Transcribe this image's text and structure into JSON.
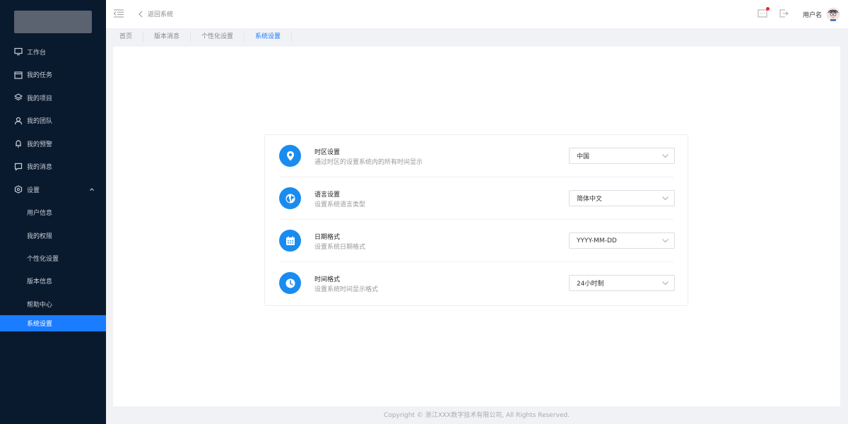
{
  "sidebar": {
    "items": [
      {
        "label": "工作台",
        "icon": "monitor-icon"
      },
      {
        "label": "我的任务",
        "icon": "calendar-icon"
      },
      {
        "label": "我的项目",
        "icon": "layers-icon"
      },
      {
        "label": "我的团队",
        "icon": "user-icon"
      },
      {
        "label": "我的预警",
        "icon": "bell-icon"
      },
      {
        "label": "我的消息",
        "icon": "message-icon"
      },
      {
        "label": "设置",
        "icon": "settings-hex-icon"
      }
    ],
    "submenu": [
      {
        "label": "用户信息"
      },
      {
        "label": "我的权限"
      },
      {
        "label": "个性化设置"
      },
      {
        "label": "版本信息"
      },
      {
        "label": "帮助中心"
      },
      {
        "label": "系统设置"
      }
    ]
  },
  "header": {
    "back_label": "返回系统",
    "username": "用户名"
  },
  "tabs": [
    {
      "label": "首页"
    },
    {
      "label": "版本消息"
    },
    {
      "label": "个性化设置"
    },
    {
      "label": "系统设置"
    }
  ],
  "settings": [
    {
      "title": "时区设置",
      "desc": "通过时区的设置系统内的所有时间显示",
      "value": "中国",
      "icon": "location-pin-icon"
    },
    {
      "title": "语言设置",
      "desc": "设置系统语言类型",
      "value": "简体中文",
      "icon": "globe-icon"
    },
    {
      "title": "日期格式",
      "desc": "设置系统日期格式",
      "value": "YYYY-MM-DD",
      "icon": "calendar-icon"
    },
    {
      "title": "时间格式",
      "desc": "设置系统时间显示格式",
      "value": "24小时制",
      "icon": "clock-icon"
    }
  ],
  "footer": "Copyright © 浙江XXX数字技术有限公司, All Rights Reserved.",
  "colors": {
    "accent": "#1a7cff",
    "sidebar": "#0a1a2e",
    "icon_circle": "#1a8cf0",
    "notify_dot": "#f5222d"
  }
}
